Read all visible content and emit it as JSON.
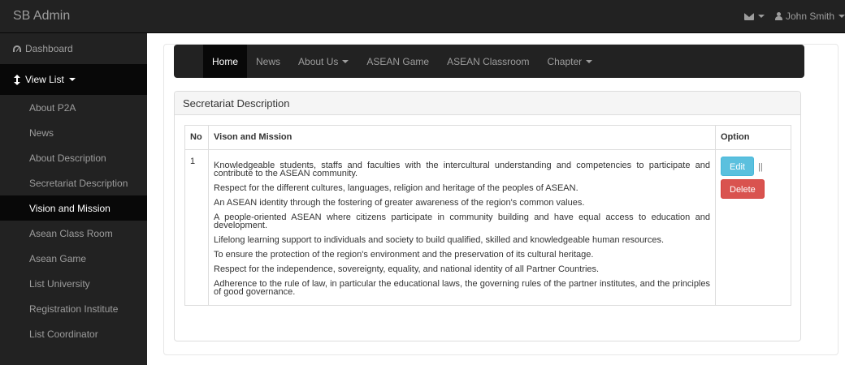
{
  "app": {
    "brand": "SB Admin"
  },
  "topbar": {
    "messages_icon": "envelope-icon",
    "user_icon": "user-icon",
    "user_name": "John Smith"
  },
  "sidebar": {
    "dashboard": {
      "label": "Dashboard",
      "icon": "dashboard-icon"
    },
    "view_list": {
      "label": "View List",
      "icon": "sort-icon"
    },
    "items": [
      {
        "label": "About P2A"
      },
      {
        "label": "News"
      },
      {
        "label": "About Description"
      },
      {
        "label": "Secretariat Description"
      },
      {
        "label": "Vision and Mission",
        "active": true
      },
      {
        "label": "Asean Class Room"
      },
      {
        "label": "Asean Game"
      },
      {
        "label": "List University"
      },
      {
        "label": "Registration Institute"
      },
      {
        "label": "List Coordinator"
      }
    ]
  },
  "navbar": {
    "links": [
      {
        "label": "Home",
        "active": true
      },
      {
        "label": "News"
      },
      {
        "label": "About Us",
        "dropdown": true
      },
      {
        "label": "ASEAN Game"
      },
      {
        "label": "ASEAN Classroom"
      },
      {
        "label": "Chapter",
        "dropdown": true
      }
    ]
  },
  "panel": {
    "heading": "Secretariat Description",
    "table": {
      "headers": {
        "no": "No",
        "mission": "Vison and Mission",
        "option": "Option"
      },
      "rows": [
        {
          "no": "1",
          "paragraphs": [
            "Knowledgeable students, staffs and faculties with the intercultural understanding and competencies to participate and contribute to the ASEAN community.",
            "Respect for the different cultures, languages, religion and heritage of the peoples of ASEAN.",
            "An ASEAN identity through the fostering of greater awareness of the region's common values.",
            "A people-oriented ASEAN where citizens participate in community building and have equal access to education and development.",
            "Lifelong learning support to individuals and society to build qualified, skilled and knowledgeable human resources.",
            "To ensure the protection of the region's environment and the preservation of its cultural heritage.",
            "Respect for the independence, sovereignty, equality, and national identity of all Partner Countries.",
            "Adherence to the rule of law, in particular the educational laws, the governing rules of the partner institutes, and the principles of good governance."
          ],
          "edit_label": "Edit",
          "separator": "||",
          "delete_label": "Delete"
        }
      ]
    }
  },
  "colors": {
    "topbar_bg": "#222222",
    "active_bg": "#080808",
    "edit_btn": "#5bc0de",
    "delete_btn": "#d9534f"
  }
}
